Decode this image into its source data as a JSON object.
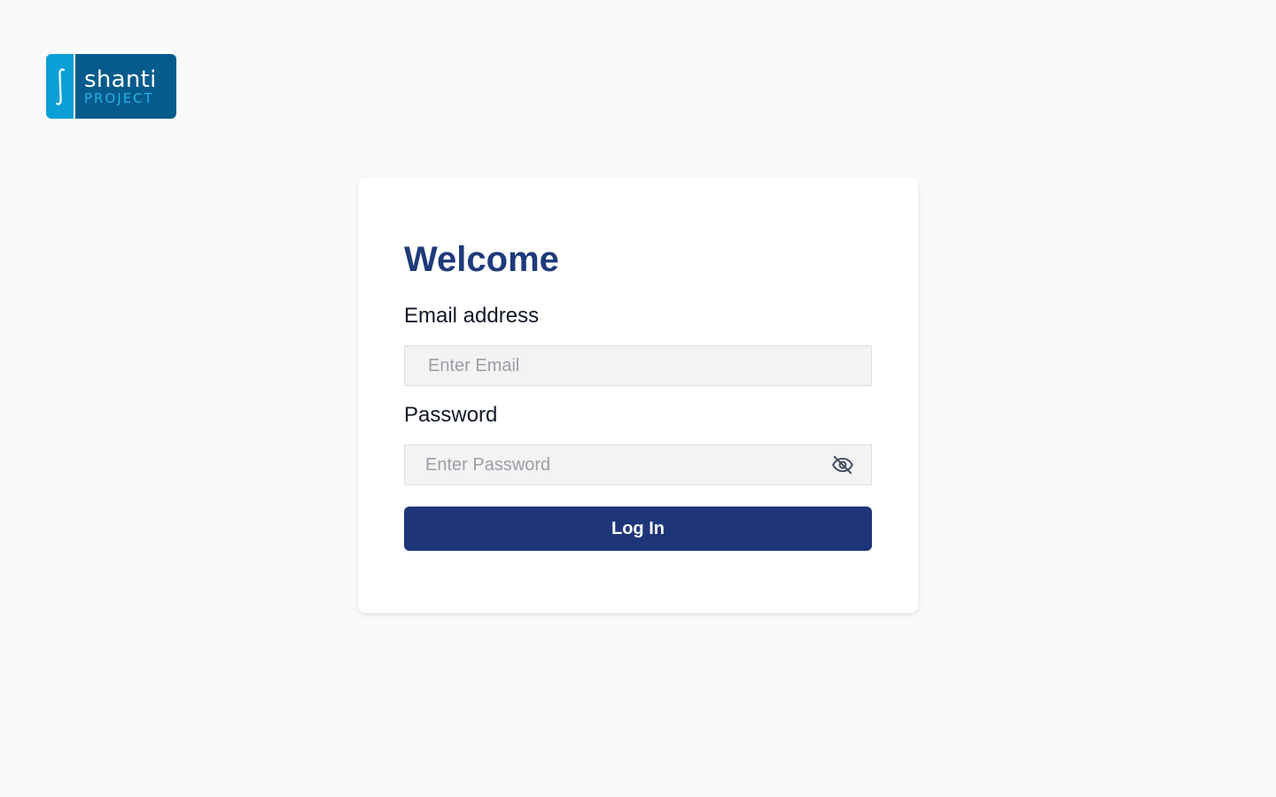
{
  "brand": {
    "name": "shanti",
    "subtitle": "PROJECT",
    "mark_icon": "integral-sign",
    "colors": {
      "mark": "#0aa0d6",
      "body": "#045b8c",
      "subtitle": "#23b2e8"
    }
  },
  "login": {
    "title": "Welcome",
    "email_label": "Email address",
    "email_placeholder": "Enter Email",
    "email_value": "",
    "password_label": "Password",
    "password_placeholder": "Enter Password",
    "password_value": "",
    "password_toggle_icon": "eye-off-icon",
    "submit_label": "Log In"
  },
  "colors": {
    "accent": "#1e3578",
    "title": "#1e3a7b",
    "background": "#fafafa",
    "card": "#ffffff",
    "input_bg": "#f3f3f3"
  }
}
